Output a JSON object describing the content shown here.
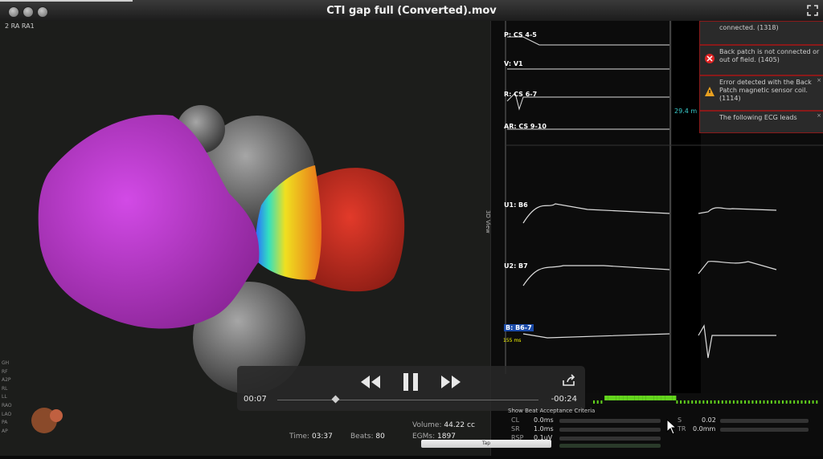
{
  "window": {
    "title": "CTI gap full (Converted).mov"
  },
  "map": {
    "label": "2 RA RA1",
    "side_labels": [
      "GH",
      "RF",
      "A2P",
      "RL",
      "LL",
      "RAO",
      "LAO",
      "PA",
      "AP"
    ]
  },
  "traces": {
    "labels": [
      "P: CS 4-5",
      "V: V1",
      "R: CS 6-7",
      "AR: CS 9-10",
      "U1: B6",
      "U2: B7",
      "B: B6-7"
    ],
    "annotation": "29.4 m",
    "timeline_time": "155 ms"
  },
  "view3d_label": "3D View",
  "alerts": [
    {
      "text": "connected. (1318)",
      "icon": "error-icon"
    },
    {
      "text": "Back patch is not connected or out of field. (1405)",
      "icon": "error-icon"
    },
    {
      "text": "Error detected with the Back Patch magnetic sensor coil. (1114)",
      "icon": "warning-icon"
    },
    {
      "text": "The following ECG leads",
      "icon": "warning-icon"
    }
  ],
  "player": {
    "elapsed": "00:07",
    "remaining": "-00:24",
    "progress": 0.22
  },
  "stats": {
    "time_label": "Time:",
    "time_value": "03:37",
    "beats_label": "Beats:",
    "beats_value": "80",
    "volume_label": "Volume:",
    "volume_value": "44.22 cc",
    "egms_label": "EGMs:",
    "egms_value": "1897"
  },
  "beat_criteria": {
    "header": "Show Beat Acceptance Criteria",
    "rows": [
      {
        "label": "CL",
        "value": "0.0ms"
      },
      {
        "label": "SR",
        "value": "1.0ms"
      },
      {
        "label": "RSP",
        "value": "0.1uV"
      }
    ],
    "right_rows": [
      {
        "label": "S",
        "value": "0.02"
      },
      {
        "label": "TR",
        "value": "0.0mm"
      }
    ]
  },
  "tap_label": "Tap",
  "colors": {
    "map_magenta": "#c23ad8",
    "map_red": "#d82a22",
    "timeline_green": "#63d41d",
    "alert_border": "#8a1a1a"
  }
}
